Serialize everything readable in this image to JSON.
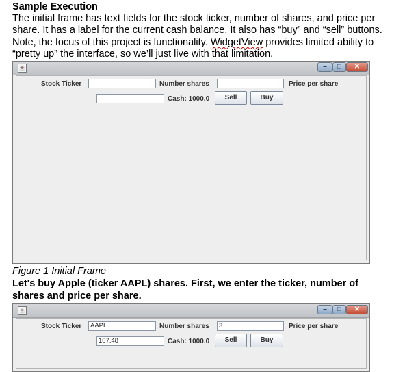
{
  "doc": {
    "heading": "Sample Execution",
    "intro_line1": "The initial frame has text fields for the stock ticker, number of shares, and price per",
    "intro_line2": "share.  It has a label for the current cash balance.  It also has “buy” and “sell” buttons.",
    "intro_line3_a": "Note, the focus of this project is functionality.  ",
    "intro_line3_widget": "WidgetView",
    "intro_line3_b": " provides limited ability to",
    "intro_line4": "“pretty up” the interface, so we’ll just live with that limitation.",
    "caption1": "Figure 1 Initial Frame",
    "para2_line1": "Let's buy Apple (ticker AAPL) shares.  First, we enter the ticker, number of",
    "para2_line2": "shares and price per share."
  },
  "window1": {
    "icon": "java-cup-icon",
    "minimize_glyph": "–",
    "maximize_glyph": "□",
    "close_glyph": "✕",
    "stock_ticker_label": "Stock Ticker",
    "stock_ticker_value": "",
    "number_shares_label": "Number shares",
    "number_shares_value": "",
    "price_per_share_label": "Price per share",
    "price_value": "",
    "cash_label": "Cash: 1000.0",
    "sell_label": "Sell",
    "buy_label": "Buy"
  },
  "window2": {
    "icon": "java-cup-icon",
    "minimize_glyph": "–",
    "maximize_glyph": "□",
    "close_glyph": "✕",
    "stock_ticker_label": "Stock Ticker",
    "stock_ticker_value": "AAPL",
    "number_shares_label": "Number shares",
    "number_shares_value": "3",
    "price_per_share_label": "Price per share",
    "price_value": "107.48",
    "cash_label": "Cash: 1000.0",
    "sell_label": "Sell",
    "buy_label": "Buy"
  }
}
